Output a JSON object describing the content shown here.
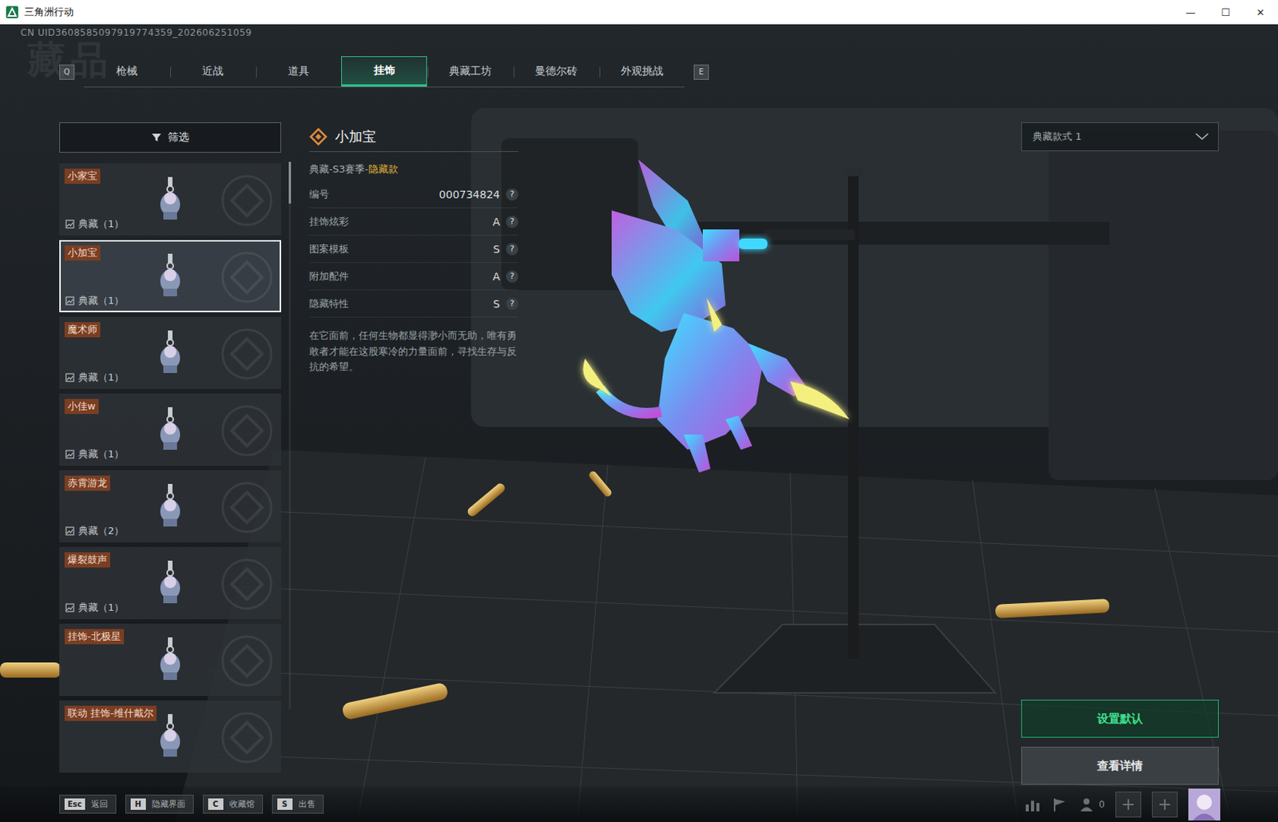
{
  "window": {
    "title": "三角洲行动",
    "controls": [
      "—",
      "☐",
      "✕"
    ]
  },
  "uid": "CN UID3608585097919774359_202606251059",
  "watermark": "藏品",
  "tab_keys": {
    "prev": "Q",
    "next": "E"
  },
  "tabs": [
    {
      "label": "枪械",
      "selected": false
    },
    {
      "label": "近战",
      "selected": false
    },
    {
      "label": "道具",
      "selected": false
    },
    {
      "label": "挂饰",
      "selected": true
    },
    {
      "label": "典藏工坊",
      "selected": false
    },
    {
      "label": "曼德尔砖",
      "selected": false
    },
    {
      "label": "外观挑战",
      "selected": false
    }
  ],
  "filter": {
    "label": "筛选"
  },
  "items": [
    {
      "name": "小家宝",
      "count": "典藏（1）",
      "selected": false
    },
    {
      "name": "小加宝",
      "count": "典藏（1）",
      "selected": true
    },
    {
      "name": "魔术师",
      "count": "典藏（1）",
      "selected": false
    },
    {
      "name": "小佳w",
      "count": "典藏（1）",
      "selected": false
    },
    {
      "name": "赤霄游龙",
      "count": "典藏（2）",
      "selected": false
    },
    {
      "name": "爆裂鼓声",
      "count": "典藏（1）",
      "selected": false
    },
    {
      "name": "挂饰-北极星",
      "count": "",
      "selected": false
    },
    {
      "name": "联动  挂饰-维什戴尔",
      "count": "",
      "selected": false
    }
  ],
  "detail": {
    "name": "小加宝",
    "subtitle": "典藏-S3赛季-",
    "highlight": "隐藏款",
    "stats": [
      {
        "label": "编号",
        "value": "000734824",
        "help": "?"
      },
      {
        "label": "挂饰炫彩",
        "value": "A",
        "help": "?"
      },
      {
        "label": "图案模板",
        "value": "S",
        "help": "?"
      },
      {
        "label": "附加配件",
        "value": "A",
        "help": "?"
      },
      {
        "label": "隐藏特性",
        "value": "S",
        "help": "?"
      }
    ],
    "description": "在它面前，任何生物都显得渺小而无助，唯有勇敢者才能在这股寒冷的力量面前，寻找生存与反抗的希望。"
  },
  "style_select": {
    "value": "典藏款式 1"
  },
  "buttons": [
    {
      "label": "设置默认",
      "kind": "primary"
    },
    {
      "label": "查看详情",
      "kind": "secondary"
    }
  ],
  "hotkeys": [
    {
      "key": "Esc",
      "label": "返回"
    },
    {
      "key": "H",
      "label": "隐藏界面"
    },
    {
      "key": "C",
      "label": "收藏馆"
    },
    {
      "key": "S",
      "label": "出售"
    }
  ],
  "status": {
    "friends": "0"
  }
}
